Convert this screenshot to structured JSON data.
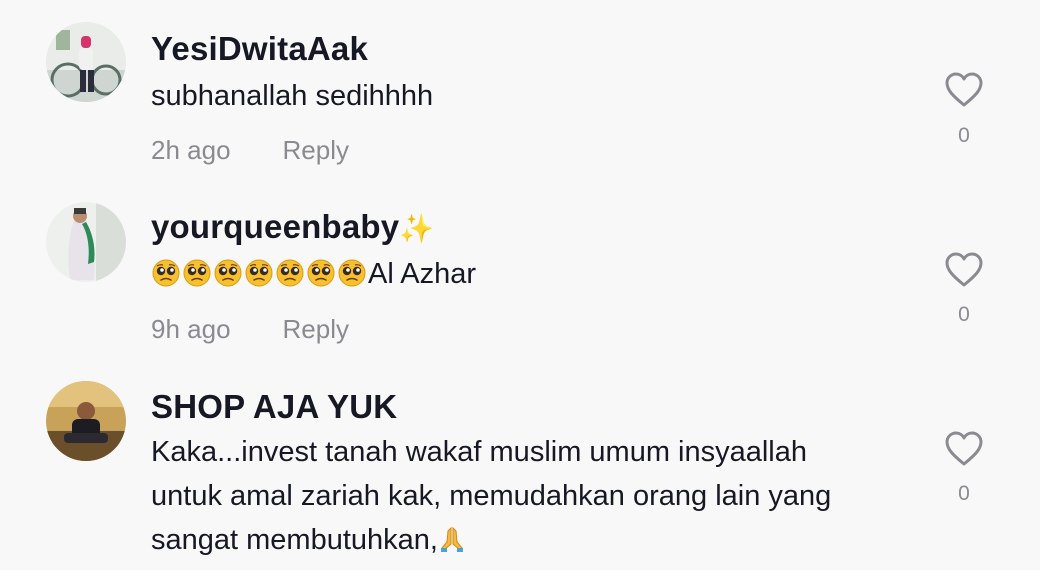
{
  "comments": [
    {
      "username": "YesiDwitaAak",
      "username_suffix": "",
      "text": "subhanallah sedihhhh",
      "time": "2h ago",
      "reply_label": "Reply",
      "like_count": "0",
      "avatar_icon": "user-photo-avatar"
    },
    {
      "username": "yourqueenbaby",
      "username_suffix": "✨",
      "text_emoji_count": 7,
      "text_emoji": "pleading-face",
      "text": "Al Azhar",
      "time": "9h ago",
      "reply_label": "Reply",
      "like_count": "0",
      "avatar_icon": "user-photo-avatar"
    },
    {
      "username": "SHOP AJA YUK",
      "username_suffix": "",
      "text_lines": [
        "Kaka...invest tanah wakaf muslim umum insyaallah",
        "untuk amal zariah kak, memudahkan orang lain yang",
        "sangat membutuhkan,"
      ],
      "text_trailing_emoji": "folded-hands",
      "like_count": "0",
      "avatar_icon": "user-photo-avatar"
    }
  ],
  "colors": {
    "background": "#f8f8f8",
    "username": "#161823",
    "text": "#161823",
    "meta": "#8a8b91",
    "heart_outline": "#8a8b91"
  }
}
